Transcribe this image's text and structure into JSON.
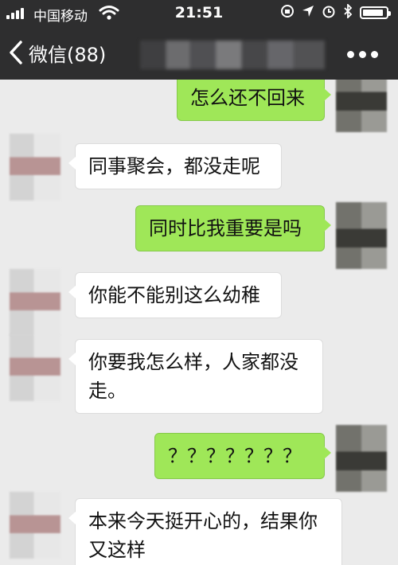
{
  "status_bar": {
    "carrier": "中国移动",
    "time": "21:51",
    "icons": [
      "signal-icon",
      "wifi-icon",
      "orientation-lock-icon",
      "location-icon",
      "alarm-icon",
      "bluetooth-icon",
      "battery-icon"
    ],
    "battery_level": 0.9
  },
  "nav": {
    "back_label": "微信(88)",
    "more_icon": "more-icon"
  },
  "messages": [
    {
      "side": "out",
      "text": "怎么还不回来"
    },
    {
      "side": "in",
      "text": "同事聚会，都没走呢"
    },
    {
      "side": "out",
      "text": "同时比我重要是吗"
    },
    {
      "side": "in",
      "text": "你能不能别这么幼稚"
    },
    {
      "side": "in",
      "text": "你要我怎么样，人家都没走。"
    },
    {
      "side": "out",
      "text": "？？？？？？？"
    },
    {
      "side": "in",
      "text": "本来今天挺开心的，结果你又这样"
    }
  ],
  "colors": {
    "nav_background": "#2e2e2f",
    "chat_background": "#ebebeb",
    "outgoing_bubble": "#9fe758",
    "incoming_bubble": "#ffffff"
  }
}
